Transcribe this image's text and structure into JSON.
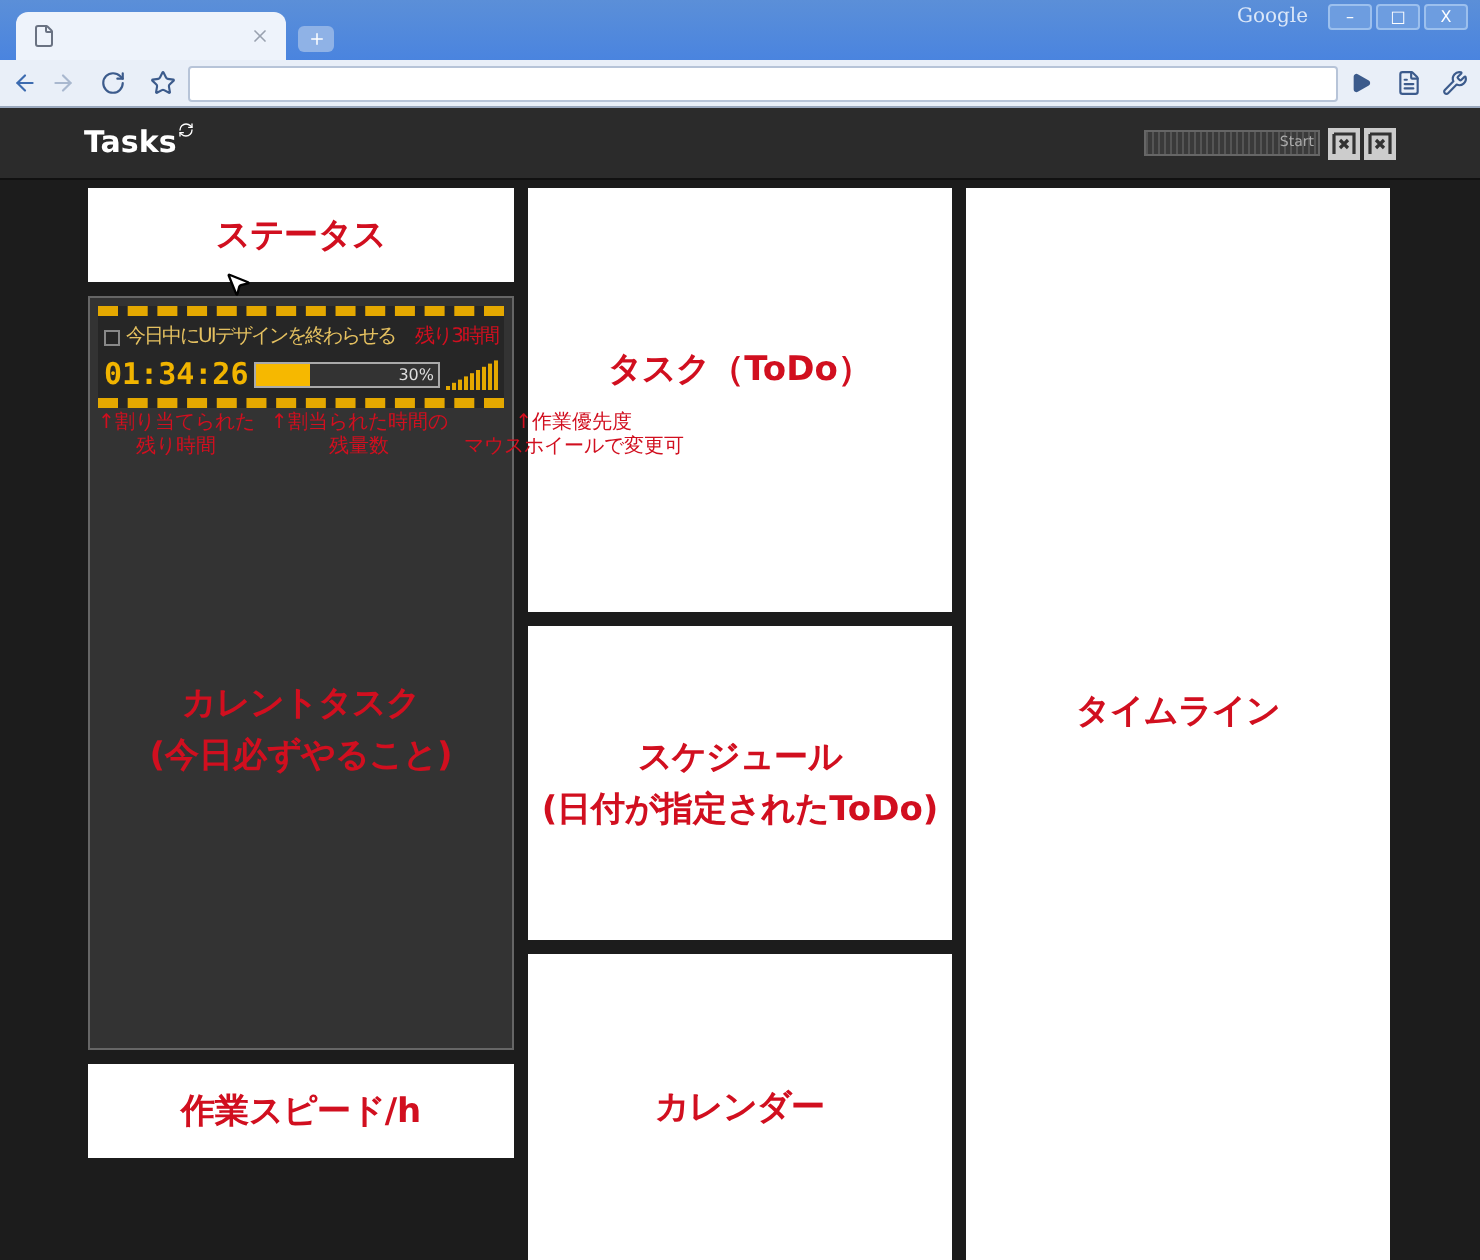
{
  "browser": {
    "brand": "Google",
    "tab": {
      "selected": true
    },
    "window_buttons": [
      "–",
      "□",
      "X"
    ]
  },
  "header": {
    "title": "Tasks",
    "start_button": "Start"
  },
  "status": {
    "title": "ステータス"
  },
  "current_task": {
    "task": {
      "title": "今日中にUIデザインを終わらせる",
      "checked": false,
      "remaining": "残り3時間",
      "timer": "01:34:26",
      "level": 0.3,
      "percent": "30%"
    },
    "annotations": [
      {
        "lines": [
          "↑割り当てられた",
          "残り時間"
        ]
      },
      {
        "lines": [
          "↑割当られた時間の",
          "残量数"
        ]
      },
      {
        "lines": [
          "↑作業優先度",
          "マウスホイールで変更可"
        ]
      }
    ],
    "title_lines": [
      "カレントタスク",
      "(今日必ずやること)"
    ]
  },
  "speed": {
    "title": "作業スピード/h"
  },
  "todo": {
    "title": "タスク（ToDo）"
  },
  "schedule": {
    "title_lines": [
      "スケジュール",
      "(日付が指定されたToDo)"
    ]
  },
  "calendar": {
    "title": "カレンダー"
  },
  "timeline": {
    "title": "タイムライン"
  }
}
